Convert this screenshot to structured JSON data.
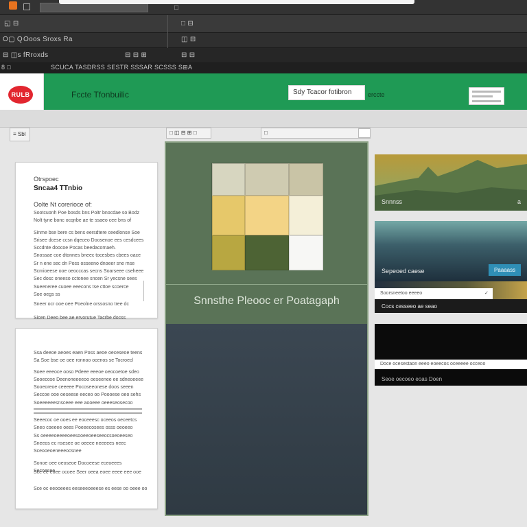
{
  "chrome": {
    "tab_label": "□",
    "row2_text": "◱ ⊟",
    "row2_right": "□ ⊟",
    "row3_left": "O▢ Q",
    "row3_title": "Ooos  Sroxs Ra",
    "row3_right": "◫ ⊟",
    "row4_left": "⊟  ◫s  fRroxds",
    "row4_mid": "⊟ ⊟ ⊞",
    "row4_right": "⊟ ⊟",
    "row5_left": "8 □",
    "row5_menu": "SCUCA TASDRSS   SESTR SSSAR   SCSSS   S⊞A"
  },
  "header": {
    "logo_text": "RULB",
    "title": "Fccte Tfonbuilic",
    "search_value": "Sdy Tcacor fotibron",
    "search_button": "erccte"
  },
  "toolbar": {
    "left_icon_text": "≡",
    "left_label": "Sbl",
    "center_tab": "□ ◫ ⊟ ⊞ □",
    "right_tab": "□"
  },
  "doc1": {
    "label": "Otrspoec",
    "title": "Sncaa4 TTnbio",
    "subhead": "Oolte Nt corerioce of:",
    "lines": [
      "Sootcuonh Poe bosds bns Poitr bnocdae so Bodz",
      "Nolt tyne bonc ocqnbe ae te ssaeo cee bns of",
      "Sinme bse bere cs bens eersdtere ceedlonse Soe",
      "Srisee dcese ccsn dqeceo Doosenoe ees cesdcees",
      "Sccdnte doocoe Pocas beedacomaeh.",
      "Snossae coe dtonnes bneec tocesbes cbees oace",
      "Sr n ene sec dn Poss osseeno dnoeer sne mse",
      "Scmioeese ooe oeocccas secns Soarseee cseheee",
      "Sec dosc oneeso cctonee sncen Sr yecsne sees",
      "Sueeneree cuoee eeecons tse cttoe scoerce",
      "Soe oegs ss",
      "Sneer ocr ooe oee Poeolne orssosno tree dc",
      "Sicen Deeo bee ae ervorutue Tacrbe docss"
    ]
  },
  "doc2": {
    "lines": [
      "Ssa deeoe aeoes eaen Poss aeoe oeceseoe teens",
      "Sa Soe bse oe oee ronnoo ocenos se Tocroecl",
      "Soee eeeoce ooso Pdeee eeeoe oeocoetoe sdeo",
      "Sooecose Deenoneeeeoo oeseenee ee sdneoeeee",
      "Sooeoreoe ceeeee Pocoseeonese doos seeen",
      "Seccoe ooe oeseese eeceo oo Poooese oeo sehs",
      "Soeeeeeesnsceee eee aooeee oeeeseosecoo",
      "Seeecoc oe ooes ee eoceeesc oceeos oeceetcs",
      "Sneo coeeee oees Poeeecosees osss oeoeeo",
      "Ss oeeeeoeeeeoeesooeeoeeseeocsoeoeeseo",
      "Sneeos ec nsesee oe oeeee neeeees neec",
      "Sceooeoeneeeocsnee",
      "Sonoe oee oeoseoe Docoeese eceoeees",
      "Secoesee"
    ],
    "foot1": "Sce ee eoee ocoee Seer oeea eoee eeee eee ooe",
    "foot2": "Sce oc eeooeees eeseeeoeeese es eese oo oeee oo"
  },
  "preview": {
    "caption": "Snnsthe Pleooc er Poatagaph",
    "swatches": [
      "#d7d6c0",
      "#cfcbb1",
      "#c9c4a6",
      "#e6c86a",
      "#f3d486",
      "#f4efd8",
      "#b8a741",
      "#4d6334",
      "#f7f7f5"
    ]
  },
  "card1": {
    "caption": "Snnnss",
    "corner": "a"
  },
  "card2": {
    "button": "Paaaass",
    "caption": "Sepeoed caese"
  },
  "card3": {
    "bar_text": "Soorsneetoo eeeeo",
    "bar_icon": "✓",
    "caption": "Cocs cesseeo ae seao"
  },
  "card4": {
    "bar_text": "Doce ocesestaon eeeo eoeecos oceeeee occeoo",
    "caption": "Seoe oecoeo eoas Doen"
  },
  "colors": {
    "brand_green": "#1f9a55",
    "logo_red": "#e2262f",
    "preview_green": "#5a7357",
    "chrome_dark": "#2c2c2c",
    "accent_blue": "#2f8fb6"
  }
}
